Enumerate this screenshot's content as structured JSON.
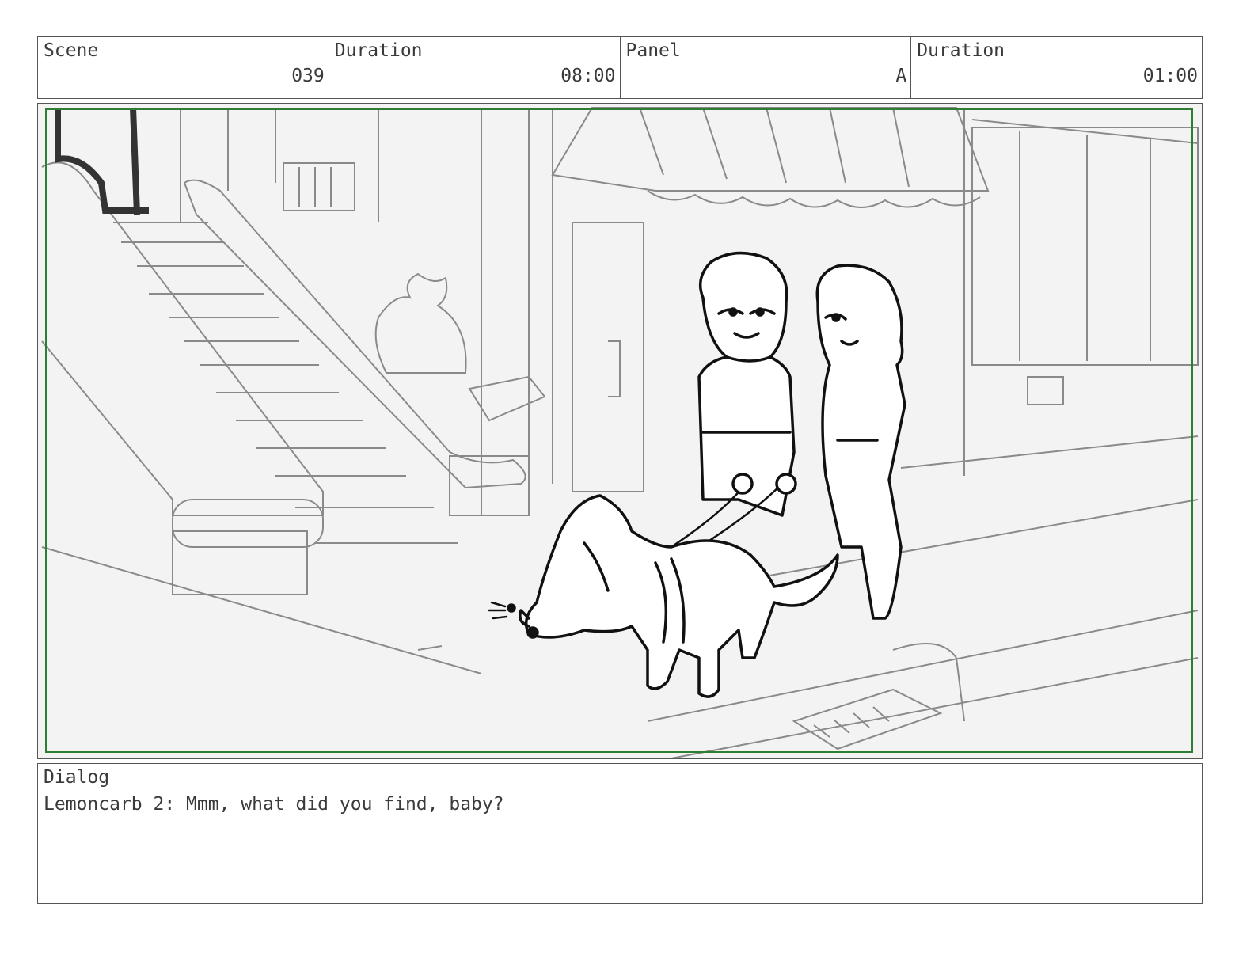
{
  "header": {
    "scene_label": "Scene",
    "scene_value": "039",
    "duration_label": "Duration",
    "duration_value": "08:00",
    "panel_label": "Panel",
    "panel_value": "A",
    "panel_duration_label": "Duration",
    "panel_duration_value": "01:00"
  },
  "dialog": {
    "label": "Dialog",
    "text": "Lemoncarb 2: Mmm, what did you find, baby?"
  },
  "colors": {
    "safe_frame": "#2e7d32",
    "background_lines": "#8a8a8a",
    "character_lines": "#111111"
  }
}
